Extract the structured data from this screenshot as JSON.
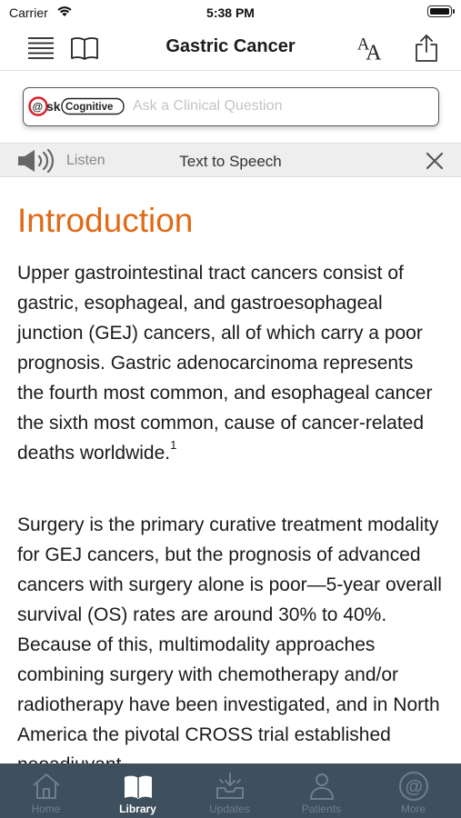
{
  "status_bar": {
    "carrier": "Carrier",
    "time": "5:38 PM"
  },
  "nav": {
    "title": "Gastric Cancer",
    "icons": [
      "menu-icon",
      "book-icon",
      "font-size-icon",
      "share-icon"
    ]
  },
  "ask": {
    "logo_text": "Cognitive",
    "placeholder": "Ask a Clinical Question"
  },
  "tts": {
    "listen_label": "Listen",
    "title": "Text to Speech"
  },
  "content": {
    "heading": "Introduction",
    "para1_text": "Upper gastrointestinal tract cancers consist of gastric, esophageal, and gastroesophageal junction (GEJ) cancers, all of which carry a poor prognosis. Gastric adenocarcinoma represents the fourth most common, and esophageal cancer the sixth most common, cause of cancer-related deaths worldwide.",
    "para1_ref": "1",
    "para2_text": "Surgery is the primary curative treatment modality for GEJ cancers, but the prognosis of advanced cancers with surgery alone is poor—5-year overall survival (OS) rates are around 30% to 40%. Because of this, multimodality approaches combining surgery with chemotherapy and/or radiotherapy have been investigated, and in North America the pivotal CROSS trial established neoadjuvant"
  },
  "tabs": [
    {
      "label": "Home",
      "icon": "home-icon",
      "active": false
    },
    {
      "label": "Library",
      "icon": "library-icon",
      "active": true
    },
    {
      "label": "Updates",
      "icon": "updates-icon",
      "active": false
    },
    {
      "label": "Patients",
      "icon": "patients-icon",
      "active": false
    },
    {
      "label": "More",
      "icon": "more-icon",
      "active": false
    }
  ],
  "colors": {
    "heading_orange": "#e06a17",
    "tab_bar_bg": "#3e4f5e",
    "ask_logo_red": "#d8222b"
  }
}
